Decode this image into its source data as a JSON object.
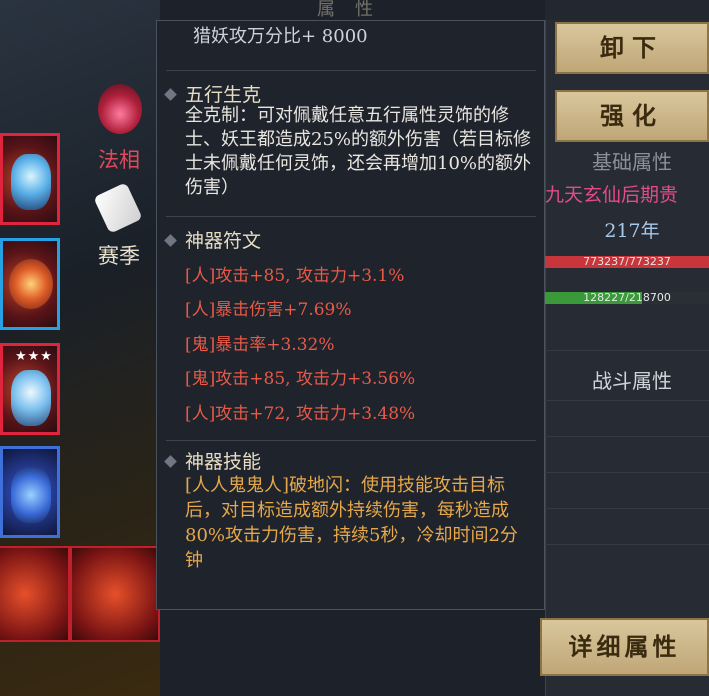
{
  "background": {
    "title": "属性"
  },
  "sidebar": {
    "fa_xiang": "法相",
    "sai_ji": "赛季",
    "stars": "★★★"
  },
  "right_panel": {
    "unequip_label": "卸下",
    "enhance_label": "强化",
    "base_attr_title": "基础属性",
    "realm": "九天玄仙后期贵",
    "age": "217年",
    "hp": "773237/773237",
    "mp": "128227/218700",
    "combat_attr_title": "战斗属性",
    "detail_label": "详细属性"
  },
  "tooltip": {
    "header_line": "猎妖攻万分比+ 8000",
    "sections": [
      {
        "title": "五行生克",
        "body": "全克制：可对佩戴任意五行属性灵饰的修士、妖王都造成25%的额外伤害（若目标修士未佩戴任何灵饰，还会再增加10%的额外伤害）"
      },
      {
        "title": "神器符文",
        "runes": [
          "[人]攻击+85, 攻击力+3.1%",
          "[人]暴击伤害+7.69%",
          "[鬼]暴击率+3.32%",
          "[鬼]攻击+85, 攻击力+3.56%",
          "[人]攻击+72, 攻击力+3.48%"
        ]
      },
      {
        "title": "神器技能",
        "body": "[人人鬼鬼人]破地闪：使用技能攻击目标后，对目标造成额外持续伤害，每秒造成80%攻击力伤害，持续5秒，冷却时间2分钟"
      }
    ]
  },
  "colors": {
    "rune": "#e85a48",
    "skill": "#e6a84a",
    "realm": "#e24a8c",
    "hp_bar": "#c8363c",
    "mp_bar": "#3a9a3a"
  }
}
